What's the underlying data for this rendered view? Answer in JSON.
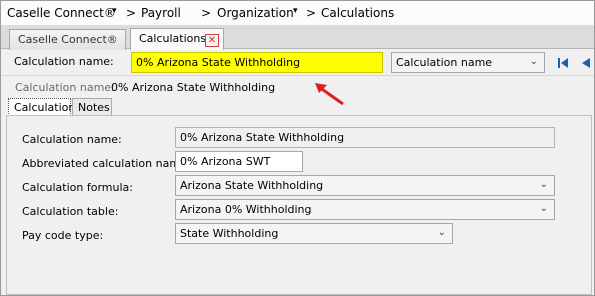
{
  "breadcrumb": {
    "items": [
      "Caselle Connect®",
      "Payroll",
      "Organization",
      "Calculations"
    ],
    "separator": ">"
  },
  "tabs": [
    {
      "label": "Caselle Connect®"
    },
    {
      "label": "Calculations"
    }
  ],
  "selector": {
    "label": "Calculation name:",
    "value": "0% Arizona State Withholding",
    "sort_option": "Calculation name",
    "highlight_color": "#ffff00"
  },
  "info": {
    "label": "Calculation name:",
    "value": "0% Arizona State Withholding"
  },
  "inner_tabs": [
    "Calculation",
    "Notes"
  ],
  "form": {
    "calc_name_label": "Calculation name:",
    "calc_name_value": "0% Arizona State Withholding",
    "abbrev_label": "Abbreviated calculation name:",
    "abbrev_value": "0% Arizona SWT",
    "formula_label": "Calculation formula:",
    "formula_value": "Arizona State Withholding",
    "table_label": "Calculation table:",
    "table_value": "Arizona 0% Withholding",
    "paycode_label": "Pay code type:",
    "paycode_value": "State Withholding"
  },
  "annotation_arrow_color": "#e02020"
}
